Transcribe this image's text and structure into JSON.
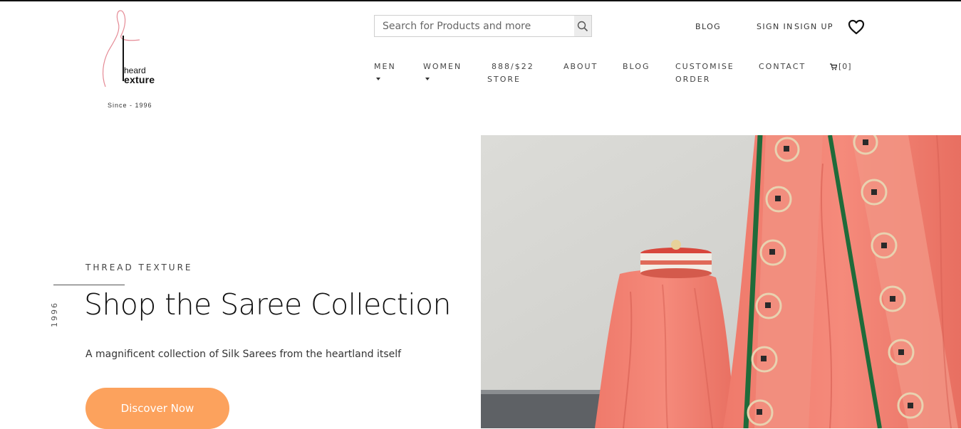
{
  "brand": {
    "logo_line1": "heard",
    "logo_line2": "exture",
    "since": "Since - 1996"
  },
  "search": {
    "placeholder": "Search for Products and more",
    "icon": "search-icon"
  },
  "utility": {
    "blog": "BLOG",
    "sign_in": "SIGN IN",
    "sign_up": "SIGN UP",
    "wishlist_icon": "heart-icon"
  },
  "nav": {
    "men": "MEN",
    "women": "WOMEN",
    "store_line1": "888/$22",
    "store_line2": "STORE",
    "about": "ABOUT",
    "blog": "BLOG",
    "customise_line1": "CUSTOMISE",
    "customise_line2": "ORDER",
    "contact": "CONTACT",
    "cart": "[0]",
    "cart_icon": "cart-icon"
  },
  "hero": {
    "eyebrow": "THREAD TEXTURE",
    "year": "1996",
    "title": "Shop the Saree Collection",
    "subtitle": "A magnificent collection of Silk Sarees from the heartland itself",
    "cta": "Discover Now",
    "cta_color": "#fca25d"
  }
}
